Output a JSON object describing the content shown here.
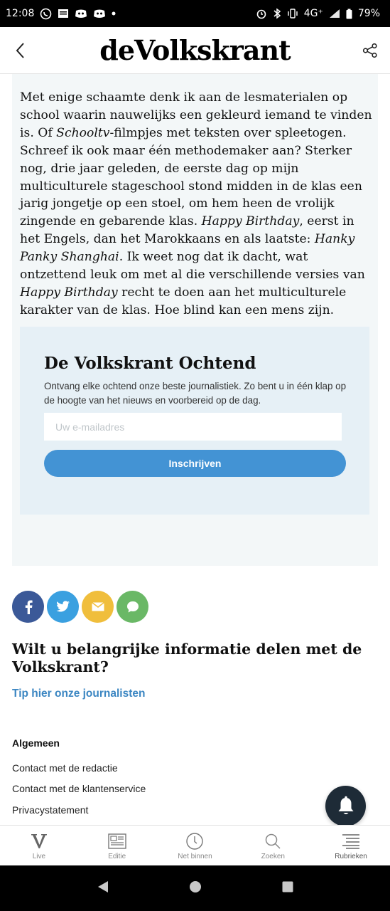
{
  "status_bar": {
    "time": "12:08",
    "network": "4G⁺",
    "battery": "79%",
    "left_icons": [
      "whatsapp-icon",
      "news-icon",
      "discord-icon",
      "discord-icon",
      "dot-icon"
    ],
    "right_icons": [
      "alarm-icon",
      "bluetooth-icon",
      "vibrate-icon",
      "signal-icon",
      "battery-icon"
    ]
  },
  "header": {
    "logo": "deVolkskrant",
    "back_icon": "chevron-left-icon",
    "share_icon": "share-icon"
  },
  "article": {
    "paragraph": [
      {
        "t": "Met enige schaamte denk ik aan de lesmaterialen op school waarin nauwelijks een gekleurd iemand te vinden is. Of ",
        "i": false
      },
      {
        "t": "Schooltv",
        "i": true
      },
      {
        "t": "-filmpjes met teksten over spleetogen. Schreef ik ook maar één methodemaker aan? Sterker nog, drie jaar geleden, de eerste dag op mijn multiculturele stageschool stond midden in de klas een jarig jongetje op een stoel, om hem heen de vrolijk zingende en gebarende klas. ",
        "i": false
      },
      {
        "t": "Happy Birthday",
        "i": true
      },
      {
        "t": ", eerst in het Engels, dan het Marokkaans en als laatste: ",
        "i": false
      },
      {
        "t": "Hanky Panky Shanghai",
        "i": true
      },
      {
        "t": ". Ik weet nog dat ik dacht, wat ontzettend leuk om met al die verschillende versies van ",
        "i": false
      },
      {
        "t": "Happy Birthday",
        "i": true
      },
      {
        "t": " recht te doen aan het multiculturele karakter van de klas. Hoe blind kan een mens zijn.",
        "i": false
      }
    ]
  },
  "newsletter": {
    "title": "De Volkskrant Ochtend",
    "description": "Ontvang elke ochtend onze beste journalistiek. Zo bent u in één klap op de hoogte van het nieuws en voorbereid op de dag.",
    "email_placeholder": "Uw e-mailadres",
    "email_value": "",
    "subscribe_label": "Inschrijven",
    "background": "#e6f0f6",
    "button_color": "#4393d4"
  },
  "share": [
    {
      "name": "facebook",
      "icon": "facebook-icon",
      "color": "#3b5998"
    },
    {
      "name": "twitter",
      "icon": "twitter-icon",
      "color": "#3aa0e0"
    },
    {
      "name": "email",
      "icon": "mail-icon",
      "color": "#f0be3c"
    },
    {
      "name": "message",
      "icon": "chat-icon",
      "color": "#6ab866"
    }
  ],
  "tip": {
    "question": "Wilt u belangrijke informatie delen met de Volkskrant?",
    "link": "Tip hier onze journalisten"
  },
  "footer": {
    "heading": "Algemeen",
    "links": [
      "Contact met de redactie",
      "Contact met de klantenservice",
      "Privacystatement"
    ]
  },
  "bottom_nav": [
    {
      "label": "Live",
      "icon": "v-logo-icon"
    },
    {
      "label": "Editie",
      "icon": "newspaper-icon"
    },
    {
      "label": "Net binnen",
      "icon": "clock-icon"
    },
    {
      "label": "Zoeken",
      "icon": "search-icon"
    },
    {
      "label": "Rubrieken",
      "icon": "menu-icon"
    }
  ],
  "colors": {
    "card_background": "#f3f7f8",
    "link": "#3b86c2",
    "bell_background": "#1e2b37"
  }
}
